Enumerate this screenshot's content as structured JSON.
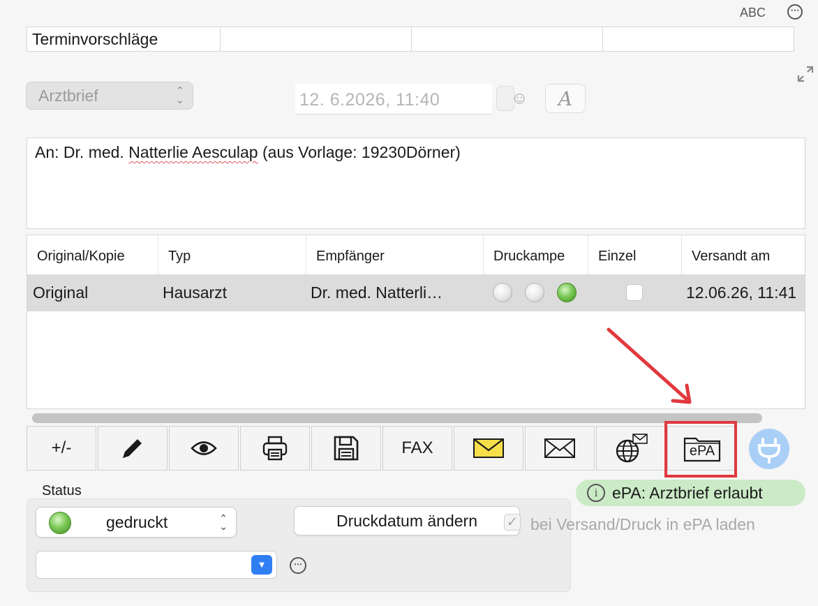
{
  "top": {
    "abc_label": "ABC",
    "more_label": "⋯"
  },
  "termin": {
    "label": "Terminvorschläge"
  },
  "form": {
    "doc_type": "Arztbrief",
    "date": "12.  6.2026, 11:40",
    "font_button": "A"
  },
  "address": {
    "prefix": "An:  Dr. med. ",
    "name_underlined": "Natterlie Aesculap",
    "suffix": " (aus Vorlage: 19230Dörner)"
  },
  "table": {
    "columns": [
      "Original/Kopie",
      "Typ",
      "Empfänger",
      "Druckampe",
      "Einzel",
      "Versandt am"
    ],
    "rows": [
      {
        "original": "Original",
        "typ": "Hausarzt",
        "empfaenger": "Dr. med. Natterli…",
        "lamps": [
          "off",
          "off",
          "on"
        ],
        "einzel": false,
        "versandt": "12.06.26, 11:41"
      }
    ]
  },
  "toolbar": {
    "plusminus": "+/-",
    "fax": "FAX",
    "epa": "ePA"
  },
  "status": {
    "label": "Status",
    "value": "gedruckt",
    "druckdatum_button": "Druckdatum ändern",
    "epa_checkbox_label": "bei Versand/Druck in ePA laden",
    "epa_badge": "ePA: Arztbrief erlaubt"
  },
  "colors": {
    "highlight": "#e0393e",
    "badge": "#cbeac6",
    "accent": "#2f7ff3"
  }
}
